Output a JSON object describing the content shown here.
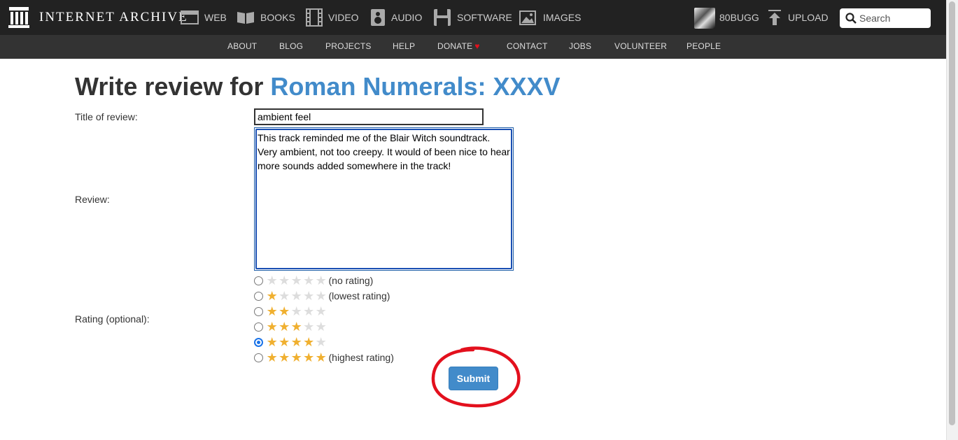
{
  "brand": {
    "name": "INTERNET ARCHIVE"
  },
  "nav": {
    "items": [
      {
        "label": "WEB",
        "icon": "web-icon"
      },
      {
        "label": "BOOKS",
        "icon": "books-icon"
      },
      {
        "label": "VIDEO",
        "icon": "video-icon"
      },
      {
        "label": "AUDIO",
        "icon": "audio-icon"
      },
      {
        "label": "SOFTWARE",
        "icon": "software-icon"
      },
      {
        "label": "IMAGES",
        "icon": "images-icon"
      }
    ],
    "username": "80BUGG",
    "upload_label": "UPLOAD",
    "search_placeholder": "Search"
  },
  "subnav": {
    "items": [
      "ABOUT",
      "BLOG",
      "PROJECTS",
      "HELP",
      "DONATE",
      "CONTACT",
      "JOBS",
      "VOLUNTEER",
      "PEOPLE"
    ]
  },
  "form": {
    "heading_prefix": "Write review for ",
    "heading_link": "Roman Numerals: XXXV",
    "title_label": "Title of review:",
    "title_value": "ambient feel",
    "review_label": "Review:",
    "review_value": "This track reminded me of the Blair Witch soundtrack. Very ambient, not too creepy. It would of been nice to hear more sounds added somewhere in the track!",
    "rating_label": "Rating (optional):",
    "rating_options": [
      {
        "stars": 0,
        "label": "(no rating)"
      },
      {
        "stars": 1,
        "label": "(lowest rating)"
      },
      {
        "stars": 2,
        "label": ""
      },
      {
        "stars": 3,
        "label": ""
      },
      {
        "stars": 4,
        "label": ""
      },
      {
        "stars": 5,
        "label": "(highest rating)"
      }
    ],
    "selected_rating": 4,
    "submit_label": "Submit"
  },
  "colors": {
    "topbar": "#222222",
    "subnav": "#333333",
    "link": "#428bca",
    "star_on": "#f0b030",
    "star_off": "#dddddd",
    "annotation": "#e3101d"
  }
}
